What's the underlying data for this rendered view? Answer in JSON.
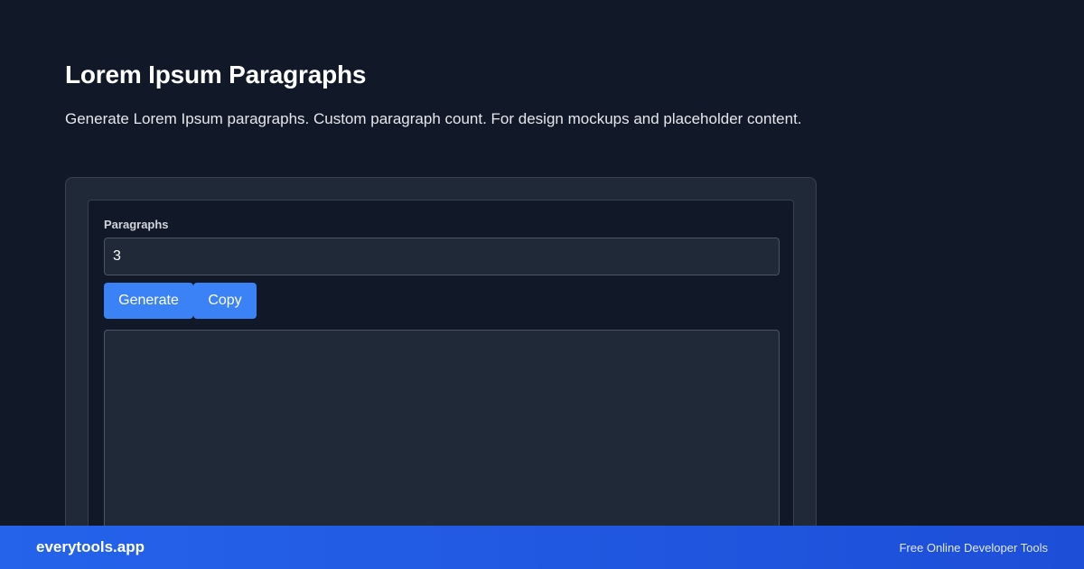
{
  "header": {
    "title": "Lorem Ipsum Paragraphs",
    "description": "Generate Lorem Ipsum paragraphs. Custom paragraph count. For design mockups and placeholder content."
  },
  "form": {
    "paragraphs_label": "Paragraphs",
    "paragraphs_value": "3",
    "generate_label": "Generate",
    "copy_label": "Copy",
    "output_value": ""
  },
  "footer": {
    "brand": "everytools.app",
    "tagline": "Free Online Developer Tools"
  },
  "colors": {
    "background": "#111827",
    "card": "#1f2937",
    "accent": "#3b82f6",
    "footer": "#2563eb"
  }
}
